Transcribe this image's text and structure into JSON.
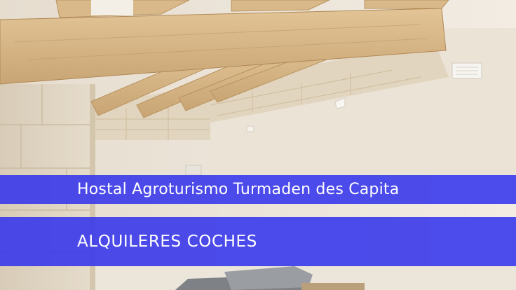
{
  "hotel": {
    "name": "Hostal Agroturismo Turmaden des Capita"
  },
  "cta": {
    "label": "ALQUILERES COCHES"
  },
  "colors": {
    "banner": "#3434ec",
    "banner_text": "#ffffff",
    "wall": "#ece4d8",
    "beam": "#d8b98a"
  }
}
